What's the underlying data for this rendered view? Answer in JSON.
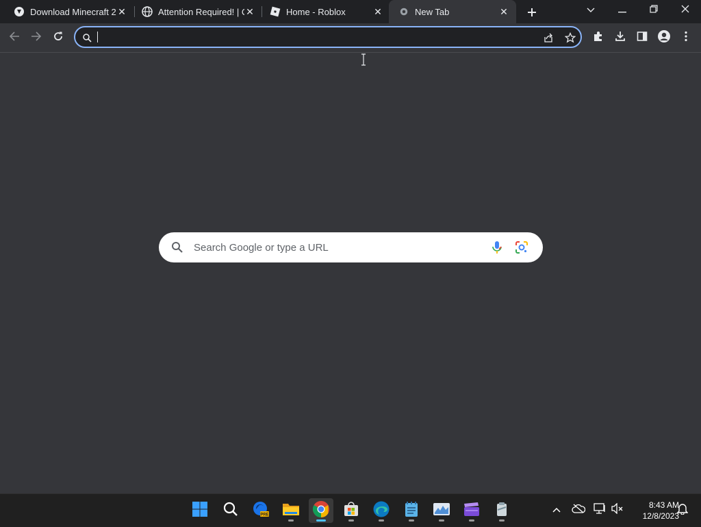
{
  "browser": {
    "tabs": [
      {
        "title": "Download Minecraft 2",
        "favicon": "minecraft-site-icon",
        "active": false
      },
      {
        "title": "Attention Required! | C",
        "favicon": "globe-icon",
        "active": false
      },
      {
        "title": "Home - Roblox",
        "favicon": "roblox-icon",
        "active": false
      },
      {
        "title": "New Tab",
        "favicon": "chrome-icon",
        "active": true
      }
    ],
    "new_tab_label": "+",
    "omnibox": {
      "value": "",
      "placeholder": ""
    }
  },
  "ntp": {
    "search_placeholder": "Search Google or type a URL"
  },
  "taskbar": {
    "apps": [
      {
        "name": "start",
        "icon": "windows-icon"
      },
      {
        "name": "search",
        "icon": "search-icon"
      },
      {
        "name": "edge-preview",
        "icon": "edge-pre-icon",
        "badge": "PRE"
      },
      {
        "name": "file-explorer",
        "icon": "folder-icon"
      },
      {
        "name": "chrome",
        "icon": "chrome-icon",
        "active": true
      },
      {
        "name": "microsoft-store",
        "icon": "store-icon"
      },
      {
        "name": "edge",
        "icon": "edge-icon"
      },
      {
        "name": "notepad",
        "icon": "notepad-icon"
      },
      {
        "name": "task-manager",
        "icon": "task-manager-icon"
      },
      {
        "name": "clipchamp",
        "icon": "clapper-icon"
      },
      {
        "name": "app",
        "icon": "app-icon"
      }
    ],
    "clock": {
      "time": "8:43 AM",
      "date": "12/8/2023"
    }
  },
  "colors": {
    "accent": "#8ab4f8",
    "taskbar_active": "#4cc2ff",
    "page_bg": "#35363a",
    "tabstrip_bg": "#202124"
  }
}
